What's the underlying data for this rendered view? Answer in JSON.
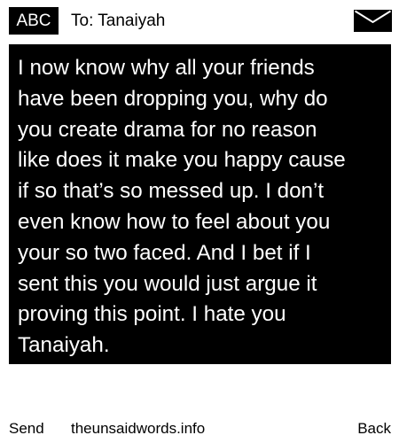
{
  "header": {
    "mode_label": "ABC",
    "recipient_label": "To: Tanaiyah",
    "message_icon": "envelope-icon"
  },
  "message": {
    "lines": [
      "I now know why all your friends",
      "have been dropping you, why do",
      "you create drama for no reason",
      "like does it make you happy cause",
      "if so that’s so messed up. I don’t",
      "even know how to feel about you",
      "your so two faced. And I bet if I",
      "sent this you would just argue it",
      "proving this point. I hate you",
      "Tanaiyah."
    ]
  },
  "softkeys": {
    "left": "Send",
    "center": "theunsaidwords.info",
    "right": "Back"
  },
  "colors": {
    "background": "#ffffff",
    "message_background": "#000000",
    "message_text": "#ffffff",
    "text": "#000000"
  }
}
